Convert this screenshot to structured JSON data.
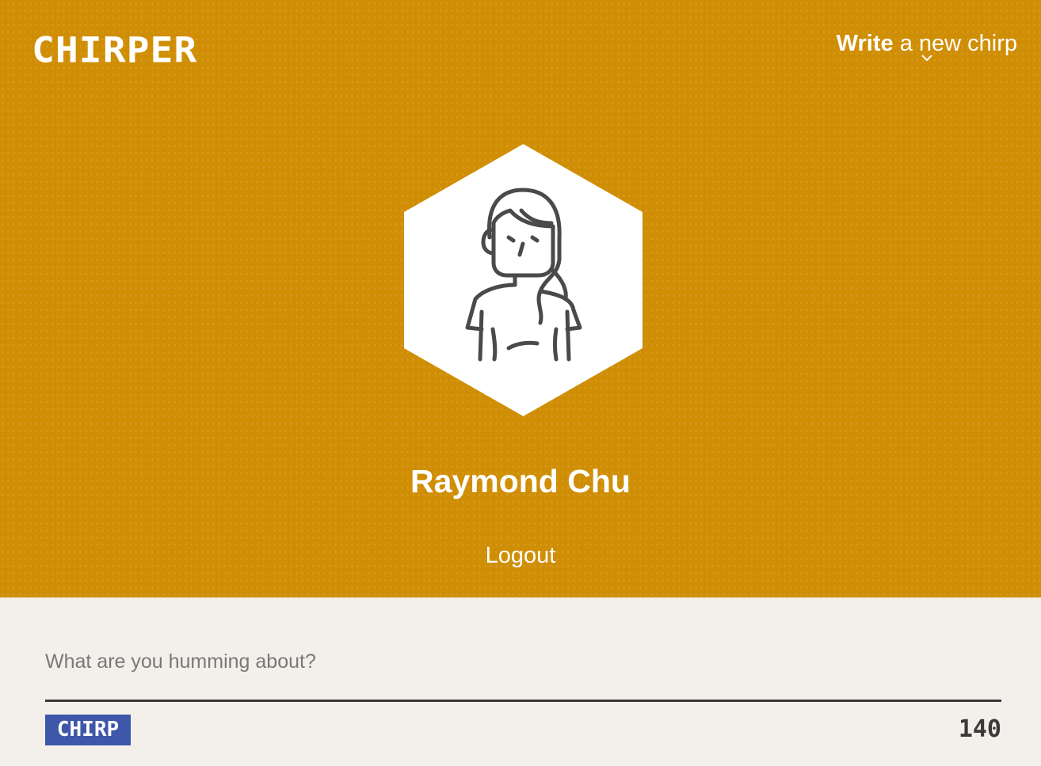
{
  "app": {
    "logo_text": "CHIRPER"
  },
  "header": {
    "write_bold": "Write",
    "write_rest": " a new chirp",
    "chevron_icon": "chevron-down-icon"
  },
  "profile": {
    "avatar_icon": "person-avatar-icon",
    "name": "Raymond Chu",
    "logout_label": "Logout"
  },
  "composer": {
    "placeholder": "What are you humming about?",
    "value": "",
    "submit_label": "CHIRP",
    "char_count": "140"
  },
  "colors": {
    "hero_background": "#d08e05",
    "composer_background": "#f3f0ec",
    "button_blue": "#3f57a8",
    "dark_text": "#3b3a39"
  }
}
